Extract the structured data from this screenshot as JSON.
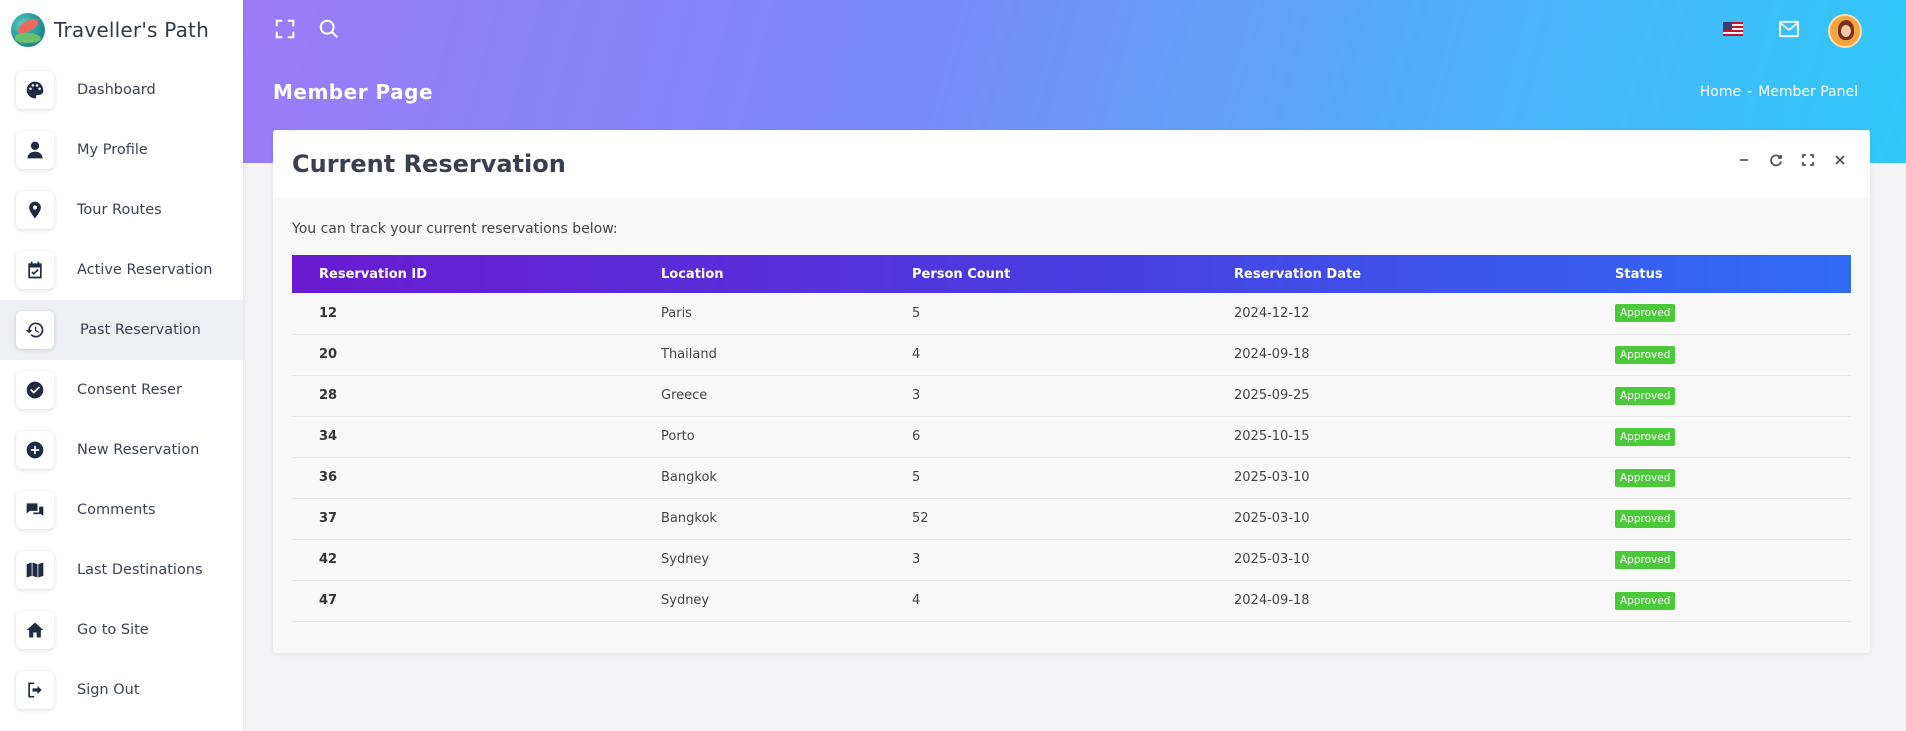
{
  "brand": {
    "name": "Traveller's Path"
  },
  "sidebar": {
    "items": [
      {
        "label": "Dashboard",
        "icon": "palette-icon"
      },
      {
        "label": "My Profile",
        "icon": "user-icon"
      },
      {
        "label": "Tour Routes",
        "icon": "map-pin-icon"
      },
      {
        "label": "Active Reservation",
        "icon": "calendar-check-icon"
      },
      {
        "label": "Past Reservation",
        "icon": "history-icon",
        "active": true
      },
      {
        "label": "Consent Reser",
        "icon": "check-circle-icon"
      },
      {
        "label": "New Reservation",
        "icon": "plus-circle-icon"
      },
      {
        "label": "Comments",
        "icon": "comments-icon"
      },
      {
        "label": "Last Destinations",
        "icon": "map-icon"
      },
      {
        "label": "Go to Site",
        "icon": "home-icon"
      },
      {
        "label": "Sign Out",
        "icon": "sign-out-icon"
      }
    ]
  },
  "header": {
    "page_title": "Member Page",
    "breadcrumb": {
      "home": "Home",
      "separator": "-",
      "current": "Member Panel"
    }
  },
  "card": {
    "title": "Current Reservation",
    "intro": "You can track your current reservations below:"
  },
  "table": {
    "columns": [
      "Reservation ID",
      "Location",
      "Person Count",
      "Reservation Date",
      "Status"
    ],
    "rows": [
      [
        "12",
        "Paris",
        "5",
        "2024-12-12",
        "Approved"
      ],
      [
        "20",
        "Thailand",
        "4",
        "2024-09-18",
        "Approved"
      ],
      [
        "28",
        "Greece",
        "3",
        "2025-09-25",
        "Approved"
      ],
      [
        "34",
        "Porto",
        "6",
        "2025-10-15",
        "Approved"
      ],
      [
        "36",
        "Bangkok",
        "5",
        "2025-03-10",
        "Approved"
      ],
      [
        "37",
        "Bangkok",
        "52",
        "2025-03-10",
        "Approved"
      ],
      [
        "42",
        "Sydney",
        "3",
        "2025-03-10",
        "Approved"
      ],
      [
        "47",
        "Sydney",
        "4",
        "2024-09-18",
        "Approved"
      ]
    ]
  },
  "colors": {
    "header_gradient_start": "#9b7cf8",
    "header_gradient_end": "#2fc8f7",
    "table_header_start": "#6a1ad0",
    "table_header_end": "#2f6cf5",
    "status_approved": "#4cc93a",
    "sidebar_icon": "#1f2a44"
  }
}
